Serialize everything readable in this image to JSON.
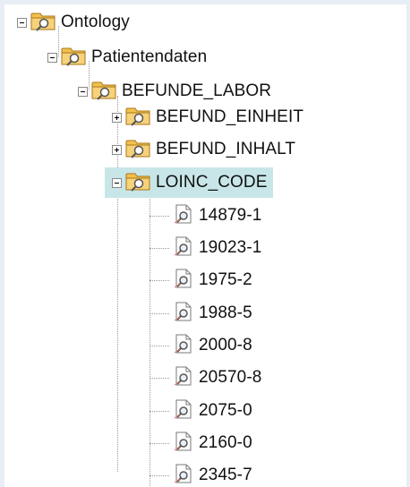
{
  "tree": {
    "root": {
      "label": "Ontology",
      "icon": "folder-search-icon",
      "expanded": true
    },
    "patientendaten": {
      "label": "Patientendaten",
      "icon": "folder-search-icon",
      "expanded": true
    },
    "befunde_labor": {
      "label": "BEFUNDE_LABOR",
      "icon": "folder-search-icon",
      "expanded": true
    },
    "befund_einheit": {
      "label": "BEFUND_EINHEIT",
      "icon": "folder-search-icon",
      "expanded": false
    },
    "befund_inhalt": {
      "label": "BEFUND_INHALT",
      "icon": "folder-search-icon",
      "expanded": false
    },
    "loinc_code": {
      "label": "LOINC_CODE",
      "icon": "folder-search-icon",
      "expanded": true,
      "selected": true
    },
    "leaves": [
      {
        "label": "14879-1",
        "icon": "document-search-icon"
      },
      {
        "label": "19023-1",
        "icon": "document-search-icon"
      },
      {
        "label": "1975-2",
        "icon": "document-search-icon"
      },
      {
        "label": "1988-5",
        "icon": "document-search-icon"
      },
      {
        "label": "2000-8",
        "icon": "document-search-icon"
      },
      {
        "label": "20570-8",
        "icon": "document-search-icon"
      },
      {
        "label": "2075-0",
        "icon": "document-search-icon"
      },
      {
        "label": "2160-0",
        "icon": "document-search-icon"
      },
      {
        "label": "2345-7",
        "icon": "document-search-icon"
      }
    ]
  },
  "colors": {
    "selection": "#c8e6e8",
    "folder": "#f2c14e",
    "tree_lines": "#9a9a9a"
  }
}
